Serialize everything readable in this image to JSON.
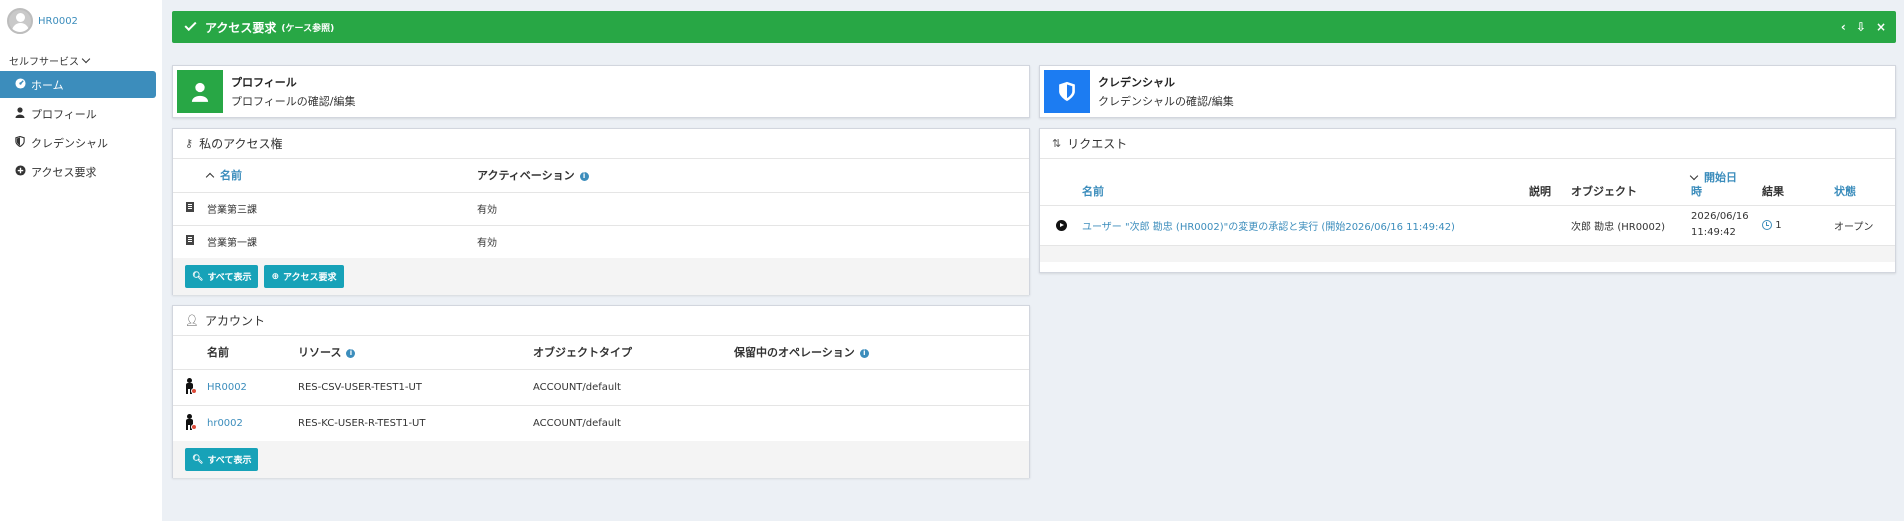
{
  "user": {
    "name": "HR0002"
  },
  "sidebar": {
    "section_label": "セルフサービス",
    "items": [
      {
        "label": "ホーム",
        "icon": "home-icon",
        "active": true
      },
      {
        "label": "プロフィール",
        "icon": "user-icon",
        "active": false
      },
      {
        "label": "クレデンシャル",
        "icon": "shield-icon",
        "active": false
      },
      {
        "label": "アクセス要求",
        "icon": "plus-circle-icon",
        "active": false
      }
    ]
  },
  "header": {
    "title": "アクセス要求",
    "subtitle": "(ケース参照)",
    "tools": [
      "‹",
      "⇩",
      "×"
    ]
  },
  "profile_card": {
    "title": "プロフィール",
    "subtitle": "プロフィールの確認/編集",
    "color": "#28a745"
  },
  "credential_card": {
    "title": "クレデンシャル",
    "subtitle": "クレデンシャルの確認/編集",
    "color": "#1c7cf2"
  },
  "access_rights": {
    "title": "私のアクセス権",
    "columns": [
      "名前",
      "アクティベーション"
    ],
    "rows": [
      {
        "name": "営業第三課",
        "activation": "有効"
      },
      {
        "name": "営業第一課",
        "activation": "有効"
      }
    ],
    "show_all_label": "すべて表示",
    "request_label": "アクセス要求"
  },
  "accounts": {
    "title": "アカウント",
    "columns": [
      "名前",
      "リソース",
      "オブジェクトタイプ",
      "保留中のオペレーション"
    ],
    "rows": [
      {
        "name": "HR0002",
        "resource": "RES-CSV-USER-TEST1-UT",
        "type": "ACCOUNT/default",
        "pending": ""
      },
      {
        "name": "hr0002",
        "resource": "RES-KC-USER-R-TEST1-UT",
        "type": "ACCOUNT/default",
        "pending": ""
      }
    ],
    "show_all_label": "すべて表示"
  },
  "requests": {
    "title": "リクエスト",
    "columns": {
      "name": "名前",
      "description": "説明",
      "object": "オブジェクト",
      "start_line1": "開始日",
      "start_line2": "時",
      "result": "結果",
      "state": "状態"
    },
    "rows": [
      {
        "name": "ユーザー \"次郎 勘忠 (HR0002)\"の変更の承認と実行 (開始2026/06/16 11:49:42)",
        "description": "",
        "object": "次郎 勘忠 (HR0002)",
        "start_date": "2026/06/16",
        "start_time": "11:49:42",
        "result": "1",
        "state": "オープン"
      }
    ]
  }
}
